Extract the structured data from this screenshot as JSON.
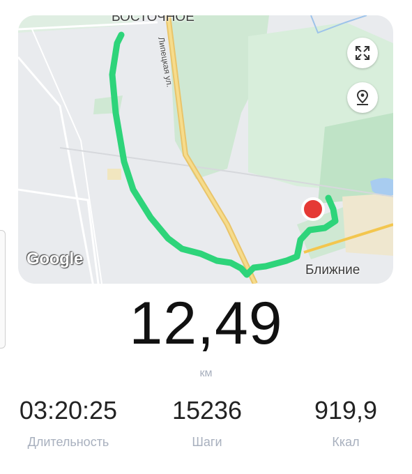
{
  "map": {
    "place_top": "ВОСТОЧНОЕ",
    "place_bottom": "Ближние",
    "road_label": "Липецкая ул.",
    "google_logo": "Google",
    "expand_button_icon": "expand-arrows-icon",
    "locate_button_icon": "location-pin-icon",
    "route_color": "#2ed47a",
    "end_marker_color": "#e53935"
  },
  "workout": {
    "distance": "12,49",
    "distance_unit": "км",
    "stats": [
      {
        "value": "03:20:25",
        "label": "Длительность"
      },
      {
        "value": "15236",
        "label": "Шаги"
      },
      {
        "value": "919,9",
        "label": "Ккал"
      }
    ]
  },
  "colors": {
    "label_gray": "#a8b0be",
    "value_dark": "#111111"
  }
}
